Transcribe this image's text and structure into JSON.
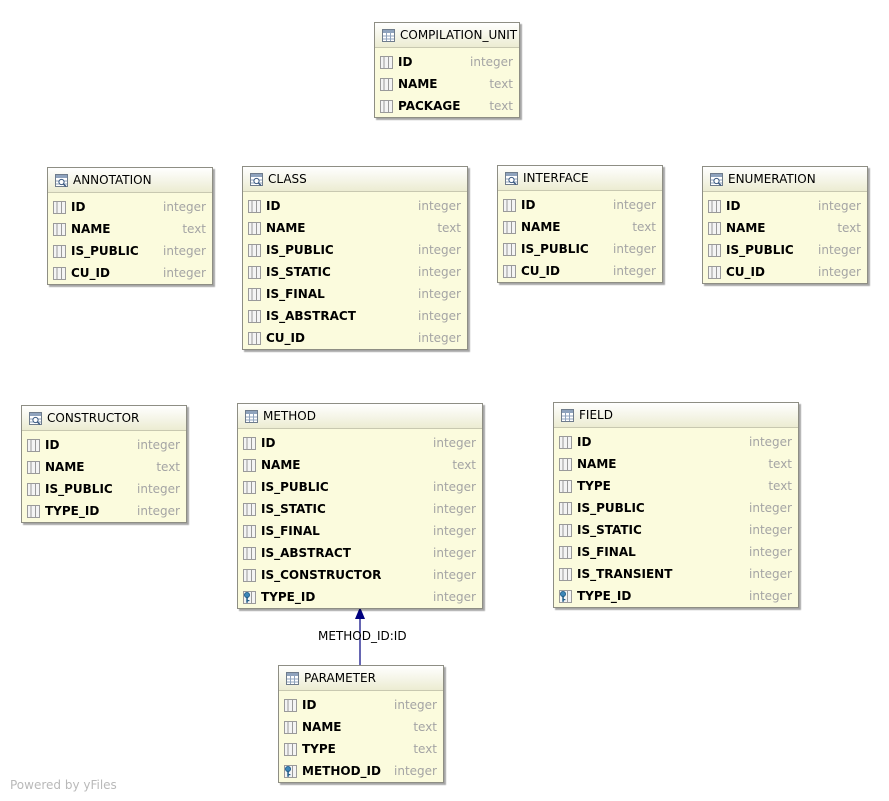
{
  "tables": [
    {
      "id": "compilation_unit",
      "title": "COMPILATION_UNIT",
      "icon": "table-icon",
      "columns": [
        {
          "name": "ID",
          "type": "integer",
          "icon": "column-icon"
        },
        {
          "name": "NAME",
          "type": "text",
          "icon": "column-icon"
        },
        {
          "name": "PACKAGE",
          "type": "text",
          "icon": "column-icon"
        }
      ]
    },
    {
      "id": "annotation",
      "title": "ANNOTATION",
      "icon": "view-icon",
      "columns": [
        {
          "name": "ID",
          "type": "integer",
          "icon": "column-icon"
        },
        {
          "name": "NAME",
          "type": "text",
          "icon": "column-icon"
        },
        {
          "name": "IS_PUBLIC",
          "type": "integer",
          "icon": "column-icon"
        },
        {
          "name": "CU_ID",
          "type": "integer",
          "icon": "column-icon"
        }
      ]
    },
    {
      "id": "class",
      "title": "CLASS",
      "icon": "view-icon",
      "columns": [
        {
          "name": "ID",
          "type": "integer",
          "icon": "column-icon"
        },
        {
          "name": "NAME",
          "type": "text",
          "icon": "column-icon"
        },
        {
          "name": "IS_PUBLIC",
          "type": "integer",
          "icon": "column-icon"
        },
        {
          "name": "IS_STATIC",
          "type": "integer",
          "icon": "column-icon"
        },
        {
          "name": "IS_FINAL",
          "type": "integer",
          "icon": "column-icon"
        },
        {
          "name": "IS_ABSTRACT",
          "type": "integer",
          "icon": "column-icon"
        },
        {
          "name": "CU_ID",
          "type": "integer",
          "icon": "column-icon"
        }
      ]
    },
    {
      "id": "interface",
      "title": "INTERFACE",
      "icon": "view-icon",
      "columns": [
        {
          "name": "ID",
          "type": "integer",
          "icon": "column-icon"
        },
        {
          "name": "NAME",
          "type": "text",
          "icon": "column-icon"
        },
        {
          "name": "IS_PUBLIC",
          "type": "integer",
          "icon": "column-icon"
        },
        {
          "name": "CU_ID",
          "type": "integer",
          "icon": "column-icon"
        }
      ]
    },
    {
      "id": "enumeration",
      "title": "ENUMERATION",
      "icon": "view-icon",
      "columns": [
        {
          "name": "ID",
          "type": "integer",
          "icon": "column-icon"
        },
        {
          "name": "NAME",
          "type": "text",
          "icon": "column-icon"
        },
        {
          "name": "IS_PUBLIC",
          "type": "integer",
          "icon": "column-icon"
        },
        {
          "name": "CU_ID",
          "type": "integer",
          "icon": "column-icon"
        }
      ]
    },
    {
      "id": "constructor",
      "title": "CONSTRUCTOR",
      "icon": "view-icon",
      "columns": [
        {
          "name": "ID",
          "type": "integer",
          "icon": "column-icon"
        },
        {
          "name": "NAME",
          "type": "text",
          "icon": "column-icon"
        },
        {
          "name": "IS_PUBLIC",
          "type": "integer",
          "icon": "column-icon"
        },
        {
          "name": "TYPE_ID",
          "type": "integer",
          "icon": "column-icon"
        }
      ]
    },
    {
      "id": "method",
      "title": "METHOD",
      "icon": "table-icon",
      "columns": [
        {
          "name": "ID",
          "type": "integer",
          "icon": "column-icon"
        },
        {
          "name": "NAME",
          "type": "text",
          "icon": "column-icon"
        },
        {
          "name": "IS_PUBLIC",
          "type": "integer",
          "icon": "column-icon"
        },
        {
          "name": "IS_STATIC",
          "type": "integer",
          "icon": "column-icon"
        },
        {
          "name": "IS_FINAL",
          "type": "integer",
          "icon": "column-icon"
        },
        {
          "name": "IS_ABSTRACT",
          "type": "integer",
          "icon": "column-icon"
        },
        {
          "name": "IS_CONSTRUCTOR",
          "type": "integer",
          "icon": "column-icon"
        },
        {
          "name": "TYPE_ID",
          "type": "integer",
          "icon": "key-column-icon"
        }
      ]
    },
    {
      "id": "field",
      "title": "FIELD",
      "icon": "table-icon",
      "columns": [
        {
          "name": "ID",
          "type": "integer",
          "icon": "column-icon"
        },
        {
          "name": "NAME",
          "type": "text",
          "icon": "column-icon"
        },
        {
          "name": "TYPE",
          "type": "text",
          "icon": "column-icon"
        },
        {
          "name": "IS_PUBLIC",
          "type": "integer",
          "icon": "column-icon"
        },
        {
          "name": "IS_STATIC",
          "type": "integer",
          "icon": "column-icon"
        },
        {
          "name": "IS_FINAL",
          "type": "integer",
          "icon": "column-icon"
        },
        {
          "name": "IS_TRANSIENT",
          "type": "integer",
          "icon": "column-icon"
        },
        {
          "name": "TYPE_ID",
          "type": "integer",
          "icon": "key-column-icon"
        }
      ]
    },
    {
      "id": "parameter",
      "title": "PARAMETER",
      "icon": "table-icon",
      "columns": [
        {
          "name": "ID",
          "type": "integer",
          "icon": "column-icon"
        },
        {
          "name": "NAME",
          "type": "text",
          "icon": "column-icon"
        },
        {
          "name": "TYPE",
          "type": "text",
          "icon": "column-icon"
        },
        {
          "name": "METHOD_ID",
          "type": "integer",
          "icon": "key-column-icon"
        }
      ]
    }
  ],
  "relations": [
    {
      "from": "parameter",
      "to": "method",
      "label": "METHOD_ID:ID",
      "color": "#00007f"
    }
  ],
  "footer": {
    "powered_by": "Powered by yFiles"
  },
  "colors": {
    "table_bg": "#fbfbdd",
    "type_text": "#a4a4a4",
    "edge": "#00007f"
  }
}
